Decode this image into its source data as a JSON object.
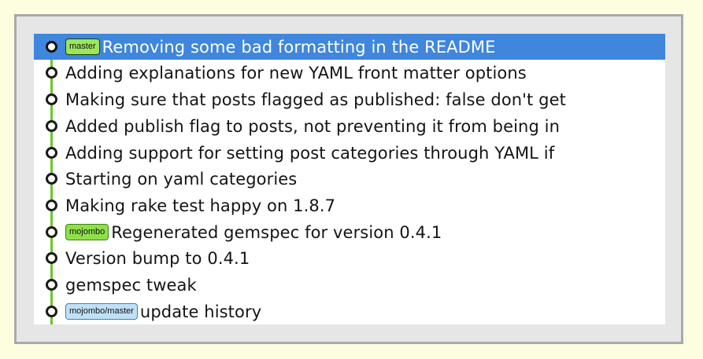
{
  "commits": [
    {
      "message": "Removing some bad formatting in the README",
      "ref": "master",
      "ref_style": "green",
      "selected": true
    },
    {
      "message": "Adding explanations for new YAML front matter options",
      "ref": "",
      "ref_style": "",
      "selected": false
    },
    {
      "message": "Making sure that posts flagged as published: false don't get",
      "ref": "",
      "ref_style": "",
      "selected": false
    },
    {
      "message": "Added publish flag to posts, not preventing it from being in",
      "ref": "",
      "ref_style": "",
      "selected": false
    },
    {
      "message": "Adding support for setting post categories through YAML if",
      "ref": "",
      "ref_style": "",
      "selected": false
    },
    {
      "message": "Starting on yaml categories",
      "ref": "",
      "ref_style": "",
      "selected": false
    },
    {
      "message": "Making rake test happy on 1.8.7",
      "ref": "",
      "ref_style": "",
      "selected": false
    },
    {
      "message": "Regenerated gemspec for version 0.4.1",
      "ref": "mojombo",
      "ref_style": "green",
      "selected": false
    },
    {
      "message": "Version bump to 0.4.1",
      "ref": "",
      "ref_style": "",
      "selected": false
    },
    {
      "message": "gemspec tweak",
      "ref": "",
      "ref_style": "",
      "selected": false
    },
    {
      "message": "update history",
      "ref": "mojombo/master",
      "ref_style": "blue",
      "selected": false
    }
  ],
  "colors": {
    "selection": "#3f86dc",
    "graph_line": "#6bc72a",
    "branch_badge": "#8ee04a",
    "remote_badge": "#bfe1f7",
    "page_background": "#fdfde0"
  },
  "icons": {
    "commit_node": "commit-node-icon",
    "graph_line": "branch-line"
  }
}
